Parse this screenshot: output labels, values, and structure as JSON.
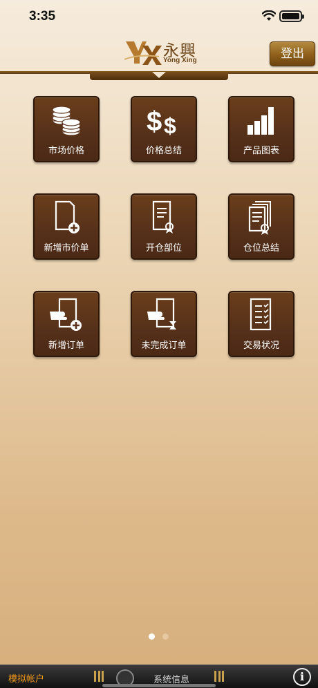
{
  "status_bar": {
    "time": "3:35"
  },
  "header": {
    "logo_cn": "永興",
    "logo_en": "Yong Xing",
    "logout_label": "登出"
  },
  "menu": [
    {
      "label": "市场价格",
      "icon": "coins-stack-icon"
    },
    {
      "label": "价格总结",
      "icon": "dollar-signs-icon"
    },
    {
      "label": "产品图表",
      "icon": "bar-chart-icon"
    },
    {
      "label": "新增市价单",
      "icon": "add-document-icon"
    },
    {
      "label": "开仓部位",
      "icon": "certificate-document-icon"
    },
    {
      "label": "仓位总结",
      "icon": "stacked-certificates-icon"
    },
    {
      "label": "新增订单",
      "icon": "hand-add-order-icon"
    },
    {
      "label": "未完成订单",
      "icon": "hand-hourglass-icon"
    },
    {
      "label": "交易状况",
      "icon": "checklist-icon"
    }
  ],
  "pager": {
    "pages": 2,
    "current": 1
  },
  "bottom_bar": {
    "account_label": "模拟帐户",
    "ticker_label": "系统信息"
  },
  "colors": {
    "tile_bg": "#5a321a",
    "accent": "#f39b19",
    "logout_bg": "#8d5f1a"
  }
}
